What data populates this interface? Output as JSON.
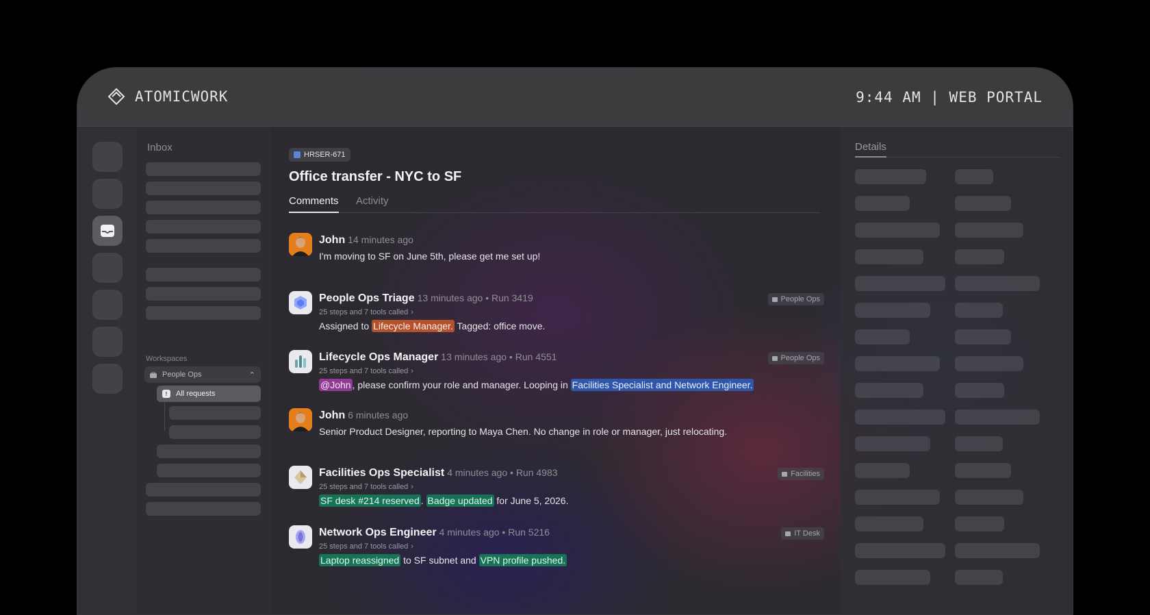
{
  "app": {
    "brand": "ATOMICWORK",
    "clock": "9:44 AM | WEB PORTAL"
  },
  "inbox": {
    "title": "Inbox",
    "workspaces_label": "Workspaces",
    "workspace": "People Ops",
    "selected_item": "All requests"
  },
  "ticket": {
    "id": "HRSER-671",
    "title": "Office transfer - NYC to SF"
  },
  "tabs": {
    "comments": "Comments",
    "activity": "Activity"
  },
  "comments": [
    {
      "author": "John",
      "meta": "14 minutes ago",
      "text": "I'm moving to SF on June 5th, please get me set up!"
    },
    {
      "author": "People Ops Triage",
      "meta": "13 minutes ago • Run 3419",
      "steps": "25 steps and 7 tools called",
      "badge": "People Ops",
      "t1": "Assigned to ",
      "h1": "Lifecycle Manager.",
      "t2": " Tagged: office move."
    },
    {
      "author": "Lifecycle Ops Manager",
      "meta": "13 minutes ago • Run 4551",
      "steps": "25 steps and 7 tools called",
      "badge": "People Ops",
      "h1": "@John",
      "t1": ", please confirm your role and manager. Looping in ",
      "h2": "Facilities Specialist and Network Engineer."
    },
    {
      "author": "John",
      "meta": "6 minutes ago",
      "text": "Senior Product Designer, reporting to Maya Chen. No change in role or manager, just relocating."
    },
    {
      "author": "Facilities Ops Specialist",
      "meta": "4 minutes ago • Run 4983",
      "steps": "25 steps and 7 tools called",
      "badge": "Facilities",
      "h1": "SF desk #214 reserved",
      "t1": ". ",
      "h2": "Badge updated",
      "t2": " for June 5, 2026."
    },
    {
      "author": "Network Ops Engineer",
      "meta": "4 minutes ago • Run 5216",
      "steps": "25 steps and 7 tools called",
      "badge": "IT Desk",
      "h1": "Laptop reassigned",
      "t1": " to SF subnet and ",
      "h2": "VPN profile pushed."
    }
  ],
  "details": {
    "title": "Details"
  },
  "icons": {
    "brand": "atomicwork-logo-icon",
    "rail_active": "inbox-tray-icon",
    "workspace": "briefcase-icon",
    "chevron": "chevron-up-icon",
    "step_caret": "chevron-right-icon"
  },
  "colors": {
    "highlight_orange": "#b4502c",
    "highlight_purple": "#8f3b94",
    "highlight_blue": "#2f56a8",
    "highlight_green": "#177256",
    "john_avatar": "#e57f1c"
  }
}
